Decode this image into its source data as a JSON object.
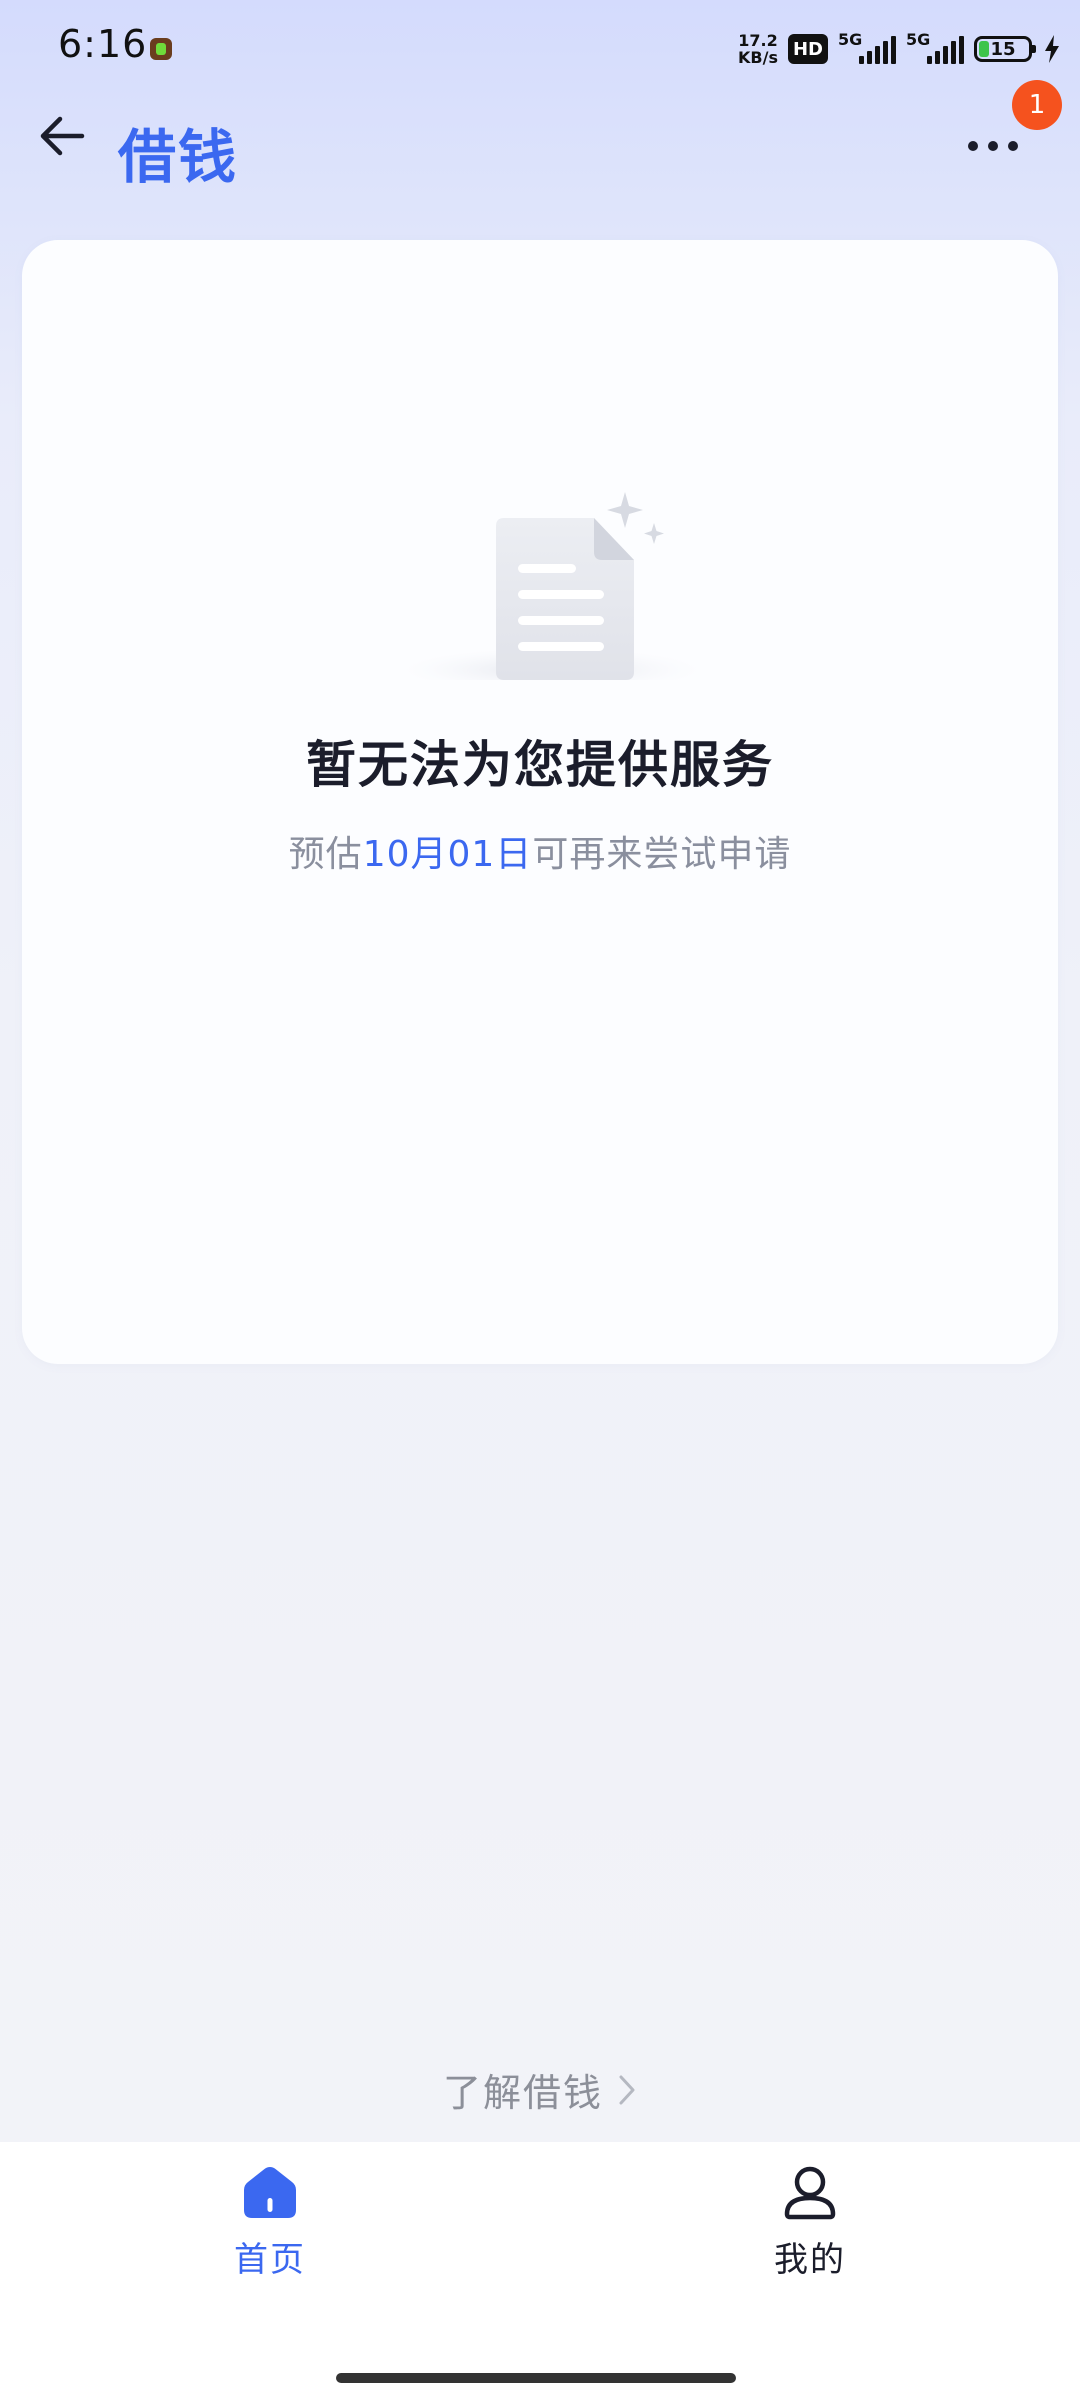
{
  "status_bar": {
    "time": "6:16",
    "net_speed_value": "17.2",
    "net_speed_unit": "KB/s",
    "hd_label": "HD",
    "signal1_label": "5G",
    "signal2_label": "5G",
    "battery_level": "15"
  },
  "header": {
    "title": "借钱",
    "notification_count": "1"
  },
  "empty_state": {
    "title": "暂无法为您提供服务",
    "subtitle_prefix": "预估",
    "subtitle_date": "10月01日",
    "subtitle_suffix": "可再来尝试申请"
  },
  "learn_link": {
    "label": "了解借钱"
  },
  "bottom_nav": {
    "items": [
      {
        "label": "首页",
        "icon": "home-icon",
        "active": true
      },
      {
        "label": "我的",
        "icon": "profile-icon",
        "active": false
      }
    ]
  },
  "colors": {
    "accent": "#3b68f0",
    "badge": "#f5521e",
    "muted_text": "#8a8f9e"
  }
}
